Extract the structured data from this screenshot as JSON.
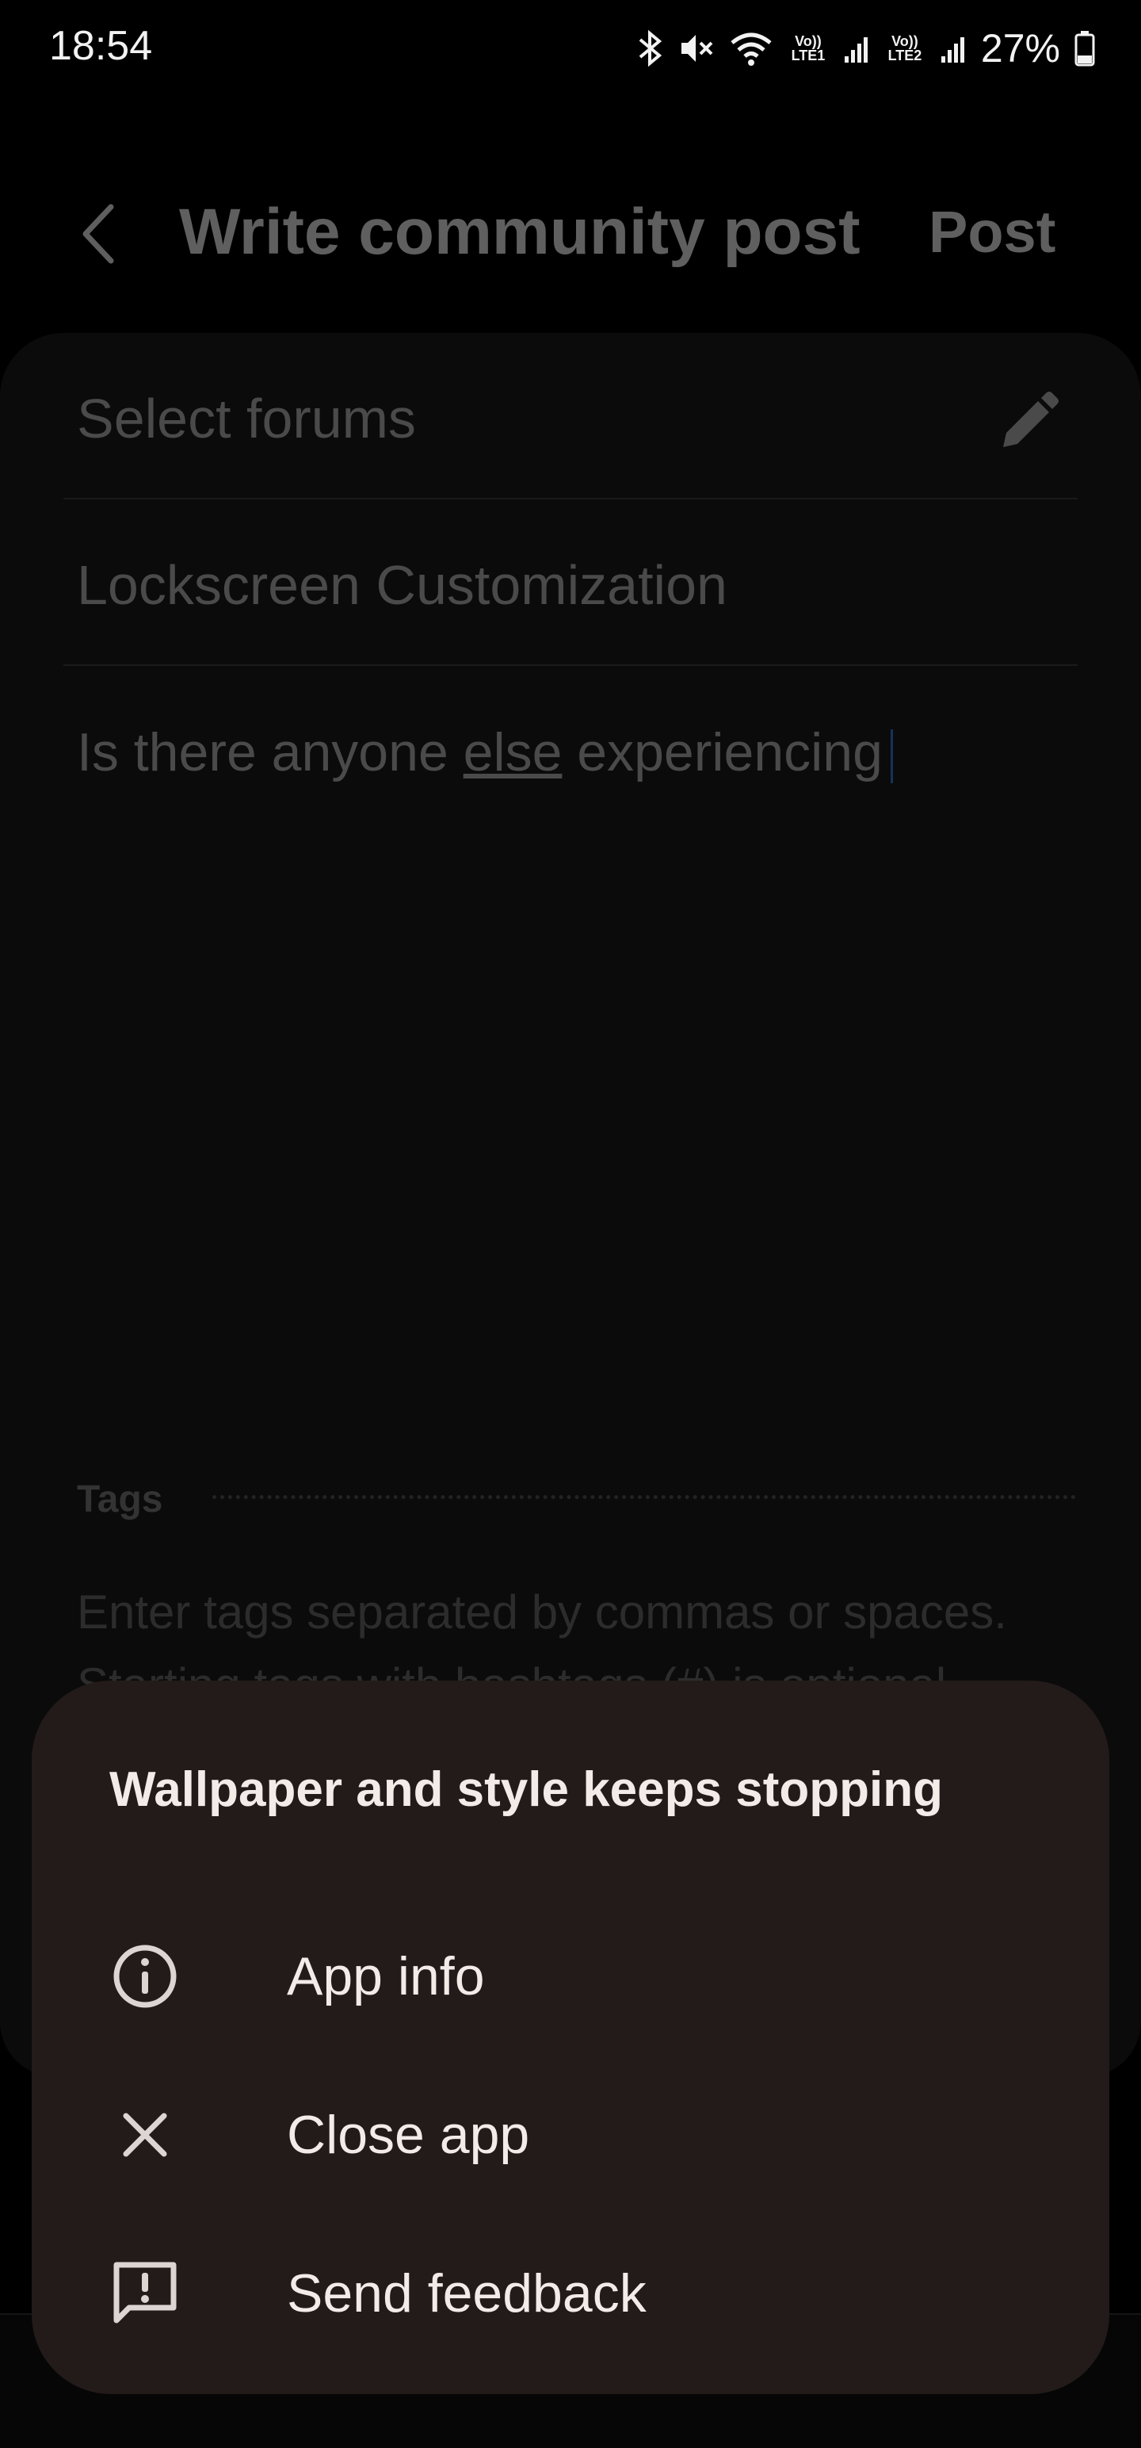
{
  "status_bar": {
    "time": "18:54",
    "network_1": "Vo)) LTE1",
    "network_2": "Vo)) LTE2",
    "battery": "27%",
    "icons": [
      "bluetooth-icon",
      "mute-icon",
      "wifi-icon",
      "signal-icon",
      "battery-icon"
    ]
  },
  "header": {
    "title": "Write community post",
    "post_label": "Post"
  },
  "form": {
    "forums_label": "Select forums",
    "title_value": "Lockscreen Customization",
    "body_before": "Is there anyone ",
    "body_underlined": "else",
    "body_after": " experiencing",
    "tags_label": "Tags",
    "tags_placeholder": "Enter tags separated by commas or spaces. Starting tags with hashtags (#) is optional."
  },
  "dialog": {
    "title": "Wallpaper and style keeps stopping",
    "items": [
      {
        "label": "App info",
        "icon": "info-icon"
      },
      {
        "label": "Close app",
        "icon": "close-icon"
      },
      {
        "label": "Send feedback",
        "icon": "feedback-icon"
      }
    ]
  },
  "colors": {
    "background": "#000000",
    "card": "#0b0b0b",
    "dialog": "#231b1a",
    "dialog_text": "#f3ebe8",
    "dimmed_text": "#4a4a4a"
  }
}
